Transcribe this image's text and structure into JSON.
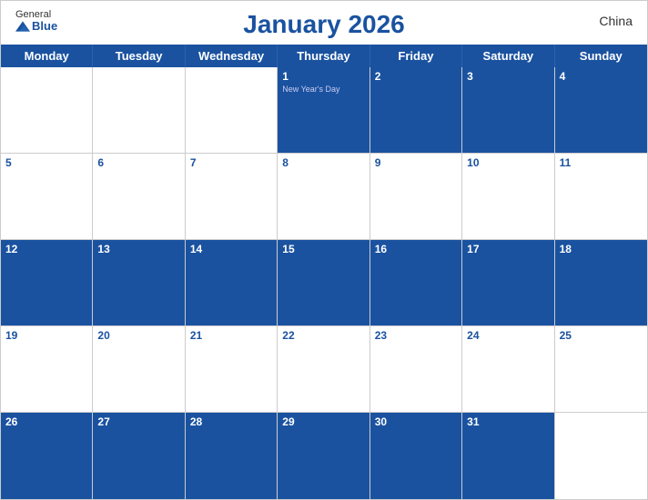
{
  "header": {
    "logo_general": "General",
    "logo_blue": "Blue",
    "title": "January 2026",
    "country": "China"
  },
  "days_of_week": [
    "Monday",
    "Tuesday",
    "Wednesday",
    "Thursday",
    "Friday",
    "Saturday",
    "Sunday"
  ],
  "weeks": [
    [
      {
        "num": "",
        "holiday": "",
        "empty": true
      },
      {
        "num": "",
        "holiday": "",
        "empty": true
      },
      {
        "num": "",
        "holiday": "",
        "empty": true
      },
      {
        "num": "1",
        "holiday": "New Year's Day",
        "empty": false
      },
      {
        "num": "2",
        "holiday": "",
        "empty": false
      },
      {
        "num": "3",
        "holiday": "",
        "empty": false
      },
      {
        "num": "4",
        "holiday": "",
        "empty": false
      }
    ],
    [
      {
        "num": "5",
        "holiday": "",
        "empty": false
      },
      {
        "num": "6",
        "holiday": "",
        "empty": false
      },
      {
        "num": "7",
        "holiday": "",
        "empty": false
      },
      {
        "num": "8",
        "holiday": "",
        "empty": false
      },
      {
        "num": "9",
        "holiday": "",
        "empty": false
      },
      {
        "num": "10",
        "holiday": "",
        "empty": false
      },
      {
        "num": "11",
        "holiday": "",
        "empty": false
      }
    ],
    [
      {
        "num": "12",
        "holiday": "",
        "empty": false
      },
      {
        "num": "13",
        "holiday": "",
        "empty": false
      },
      {
        "num": "14",
        "holiday": "",
        "empty": false
      },
      {
        "num": "15",
        "holiday": "",
        "empty": false
      },
      {
        "num": "16",
        "holiday": "",
        "empty": false
      },
      {
        "num": "17",
        "holiday": "",
        "empty": false
      },
      {
        "num": "18",
        "holiday": "",
        "empty": false
      }
    ],
    [
      {
        "num": "19",
        "holiday": "",
        "empty": false
      },
      {
        "num": "20",
        "holiday": "",
        "empty": false
      },
      {
        "num": "21",
        "holiday": "",
        "empty": false
      },
      {
        "num": "22",
        "holiday": "",
        "empty": false
      },
      {
        "num": "23",
        "holiday": "",
        "empty": false
      },
      {
        "num": "24",
        "holiday": "",
        "empty": false
      },
      {
        "num": "25",
        "holiday": "",
        "empty": false
      }
    ],
    [
      {
        "num": "26",
        "holiday": "",
        "empty": false
      },
      {
        "num": "27",
        "holiday": "",
        "empty": false
      },
      {
        "num": "28",
        "holiday": "",
        "empty": false
      },
      {
        "num": "29",
        "holiday": "",
        "empty": false
      },
      {
        "num": "30",
        "holiday": "",
        "empty": false
      },
      {
        "num": "31",
        "holiday": "",
        "empty": false
      },
      {
        "num": "",
        "holiday": "",
        "empty": true
      }
    ]
  ],
  "colors": {
    "blue": "#1a52a0",
    "header_text": "#ffffff",
    "day_num": "#1a52a0"
  }
}
